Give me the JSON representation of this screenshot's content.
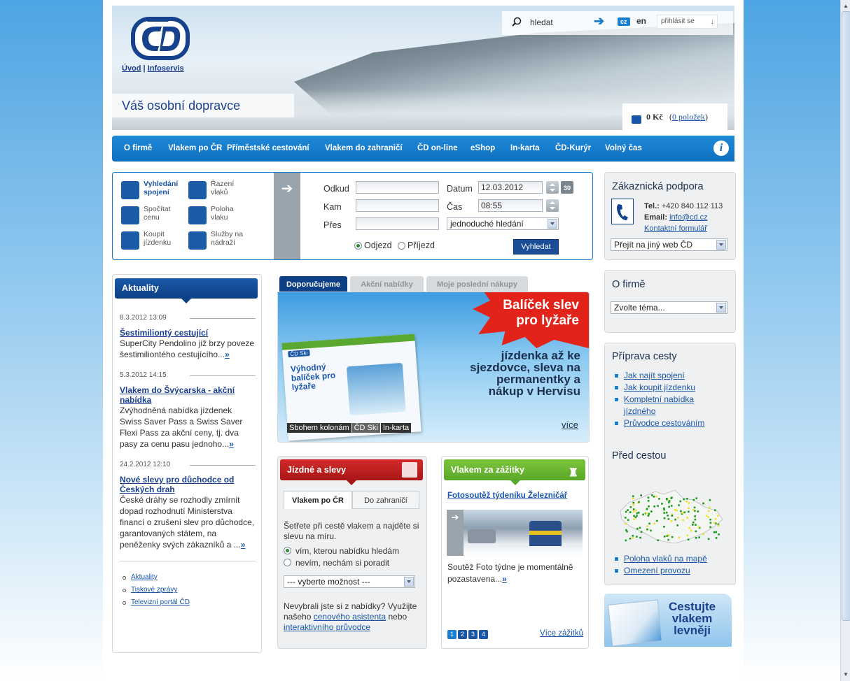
{
  "header": {
    "links": [
      "Úvod",
      "Infoservis"
    ],
    "slogan": "Váš osobní dopravce",
    "search_value": "hledat",
    "lang_cz": "cz",
    "lang_en": "en",
    "login": "přihlásit se",
    "cart_price": "0 Kč",
    "cart_items": "0 položek"
  },
  "nav": [
    "O firmě",
    "Vlakem po ČR",
    "Příměstské cestování",
    "Vlakem do zahraničí",
    "ČD on-line",
    "eShop",
    "In-karta",
    "ČD-Kurýr",
    "Volný čas"
  ],
  "quicklinks": [
    {
      "label1": "Vyhledání",
      "label2": "spojení",
      "icon": "laptop-icon"
    },
    {
      "label1": "Řazení",
      "label2": "vlaků",
      "icon": "train-composition-icon"
    },
    {
      "label1": "Spočítat",
      "label2": "cenu",
      "icon": "coins-icon"
    },
    {
      "label1": "Poloha",
      "label2": "vlaku",
      "icon": "train-location-icon"
    },
    {
      "label1": "Koupit",
      "label2": "jízdenku",
      "icon": "ticket-icon"
    },
    {
      "label1": "Služby na",
      "label2": "nádraží",
      "icon": "station-services-icon"
    }
  ],
  "search": {
    "from_label": "Odkud",
    "to_label": "Kam",
    "via_label": "Přes",
    "date_label": "Datum",
    "date_value": "12.03.2012",
    "time_label": "Čas",
    "time_value": "08:55",
    "mode_value": "jednoduché hledání",
    "departure": "Odjezd",
    "arrival": "Příjezd",
    "submit": "Vyhledat",
    "calendar_day": "30"
  },
  "support": {
    "title": "Zákaznická podpora",
    "tel_label": "Tel.:",
    "tel": "+420 840 112 113",
    "email_label": "Email:",
    "email": "info@cd.cz",
    "form": "Kontaktní formulář",
    "select": "Přejít na jiný web ČD"
  },
  "ofirme": {
    "title": "O firmě",
    "select": "Zvolte téma..."
  },
  "priprava": {
    "title": "Příprava cesty",
    "items": [
      "Jak najít spojení",
      "Jak koupit jízdenku",
      "Kompletní nabídka jízdného",
      "Průvodce cestováním"
    ],
    "title2": "Před cestou",
    "items2": [
      "Poloha vlaků na mapě",
      "Omezení provozu"
    ]
  },
  "aktuality": {
    "title": "Aktuality",
    "news": [
      {
        "date": "8.3.2012 13:09",
        "title": "Šestimiliontý cestující",
        "body": "SuperCity Pendolino již brzy poveze šestimiliontého cestujícího...",
        "more": "»"
      },
      {
        "date": "5.3.2012 14:15",
        "title": "Vlakem do Švýcarska - akční nabídka",
        "body": "Zvýhodněná nabídka jízdenek Swiss Saver Pass a Swiss Saver Flexi Pass za akční ceny, tj. dva pasy za cenu pasu jednoho...",
        "more": "»"
      },
      {
        "date": "24.2.2012 12:10",
        "title": "Nové slevy pro důchodce od Českých drah",
        "body": "České dráhy se rozhodly zmírnit dopad rozhodnutí Ministerstva financí o zrušení slev pro důchodce, garantovaných státem, na peněženky svých zákazníků a ...",
        "more": "»"
      }
    ],
    "links": [
      "Aktuality",
      "Tiskové zprávy",
      "Televizní portál ČD"
    ]
  },
  "tabs": [
    "Doporučujeme",
    "Akční nabídky",
    "Moje poslední nákupy"
  ],
  "promo": {
    "burst": "Balíček slev pro lyžaře",
    "card_brand": "ČD Ski",
    "card_title": "Výhodný balíček pro lyžaře",
    "text": "jízdenka až ke sjezdovce, sleva na permanentky a nákup v Hervisu",
    "more": "více",
    "tags": [
      "Sbohem kolonám",
      "ČD Ski",
      "In-karta"
    ]
  },
  "jizdne": {
    "title": "Jízdné a slevy",
    "tab1": "Vlakem po ČR",
    "tab2": "Do zahraničí",
    "intro": "Šetřete při cestě vlakem a najděte si slevu na míru.",
    "opt1": "vím, kterou nabídku hledám",
    "opt2": "nevím, nechám si poradit",
    "select": "--- vyberte možnost ---",
    "footer1": "Nevybrali jste si z nabídky? Využijte našeho",
    "link1": "cenového asistenta",
    "mid": "nebo",
    "link2": "interaktivního průvodce"
  },
  "zazitky": {
    "title": "Vlakem za zážitky",
    "link": "Fotosoutěž týdeníku Železničář",
    "text": "Soutěž Foto týdne je momentálně pozastavena...",
    "more": "»",
    "pages": [
      "1",
      "2",
      "3",
      "4"
    ],
    "more_link": "Více zážitků"
  },
  "promoR": {
    "line1": "Cestujte",
    "line2": "vlakem",
    "line3": "levněji"
  }
}
